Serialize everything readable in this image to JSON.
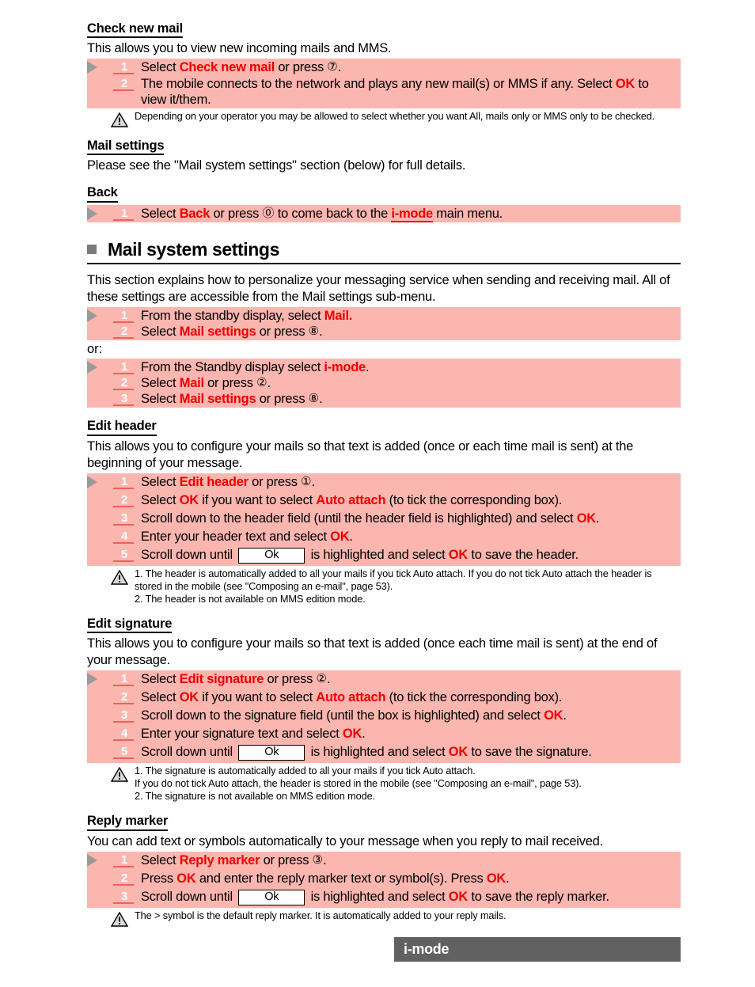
{
  "document": {
    "footer_label": "i-mode"
  },
  "sections": [
    {
      "id": "check-new-mail",
      "heading": "Check new mail",
      "intro": "This allows you to view new incoming mails and MMS.",
      "steps": [
        {
          "num": "1",
          "parts": [
            {
              "t": "text",
              "v": "Select "
            },
            {
              "t": "red",
              "v": "Check new mail"
            },
            {
              "t": "text",
              "v": " or press "
            },
            {
              "t": "circled",
              "v": "⑦"
            },
            {
              "t": "text",
              "v": "."
            }
          ]
        },
        {
          "num": "2",
          "parts": [
            {
              "t": "text",
              "v": "The mobile connects to the network and plays any new mail(s) or MMS if any. Select "
            },
            {
              "t": "red",
              "v": "OK"
            },
            {
              "t": "text",
              "v": " to view it/them."
            }
          ]
        }
      ],
      "note": "Depending on your operator you may be allowed to select whether you want All, mails only or MMS only to be checked."
    },
    {
      "id": "mail-settings",
      "heading": "Mail settings",
      "intro": "Please see the \"Mail system settings\" section (below) for full details."
    },
    {
      "id": "back",
      "heading": "Back",
      "steps": [
        {
          "num": "1",
          "parts": [
            {
              "t": "text",
              "v": "Select "
            },
            {
              "t": "red",
              "v": "Back"
            },
            {
              "t": "text",
              "v": "  or press "
            },
            {
              "t": "circled",
              "v": "⓪"
            },
            {
              "t": "text",
              "v": " to come back to the "
            },
            {
              "t": "imode",
              "v": "i-mode"
            },
            {
              "t": "text",
              "v": " main menu."
            }
          ]
        }
      ]
    }
  ],
  "main_section": {
    "title": "Mail system settings",
    "intro": "This section explains how to personalize your messaging service when sending and receiving mail. All of these settings are accessible from the Mail settings sub-menu.",
    "steps_a": [
      {
        "num": "1",
        "parts": [
          {
            "t": "text",
            "v": "From the standby display, select "
          },
          {
            "t": "red",
            "v": "Mail."
          }
        ]
      },
      {
        "num": "2",
        "parts": [
          {
            "t": "text",
            "v": "Select "
          },
          {
            "t": "red",
            "v": "Mail settings"
          },
          {
            "t": "text",
            "v": " or press "
          },
          {
            "t": "circled",
            "v": "⑧"
          },
          {
            "t": "text",
            "v": "."
          }
        ]
      }
    ],
    "or_label": "or:",
    "steps_b": [
      {
        "num": "1",
        "parts": [
          {
            "t": "text",
            "v": "From the Standby display select "
          },
          {
            "t": "red",
            "v": "i-mode"
          },
          {
            "t": "text",
            "v": "."
          }
        ]
      },
      {
        "num": "2",
        "parts": [
          {
            "t": "text",
            "v": "Select "
          },
          {
            "t": "red",
            "v": "Mail"
          },
          {
            "t": "text",
            "v": " or press "
          },
          {
            "t": "circled",
            "v": "②"
          },
          {
            "t": "text",
            "v": "."
          }
        ]
      },
      {
        "num": "3",
        "parts": [
          {
            "t": "text",
            "v": "Select "
          },
          {
            "t": "red",
            "v": "Mail settings"
          },
          {
            "t": "text",
            "v": " or press "
          },
          {
            "t": "circled",
            "v": "⑧"
          },
          {
            "t": "text",
            "v": "."
          }
        ]
      }
    ]
  },
  "edit_header": {
    "heading": "Edit header",
    "intro": "This allows you to configure your mails so that text is added (once or each time mail is sent) at the beginning of your message.",
    "steps": [
      {
        "num": "1",
        "parts": [
          {
            "t": "text",
            "v": "Select "
          },
          {
            "t": "red",
            "v": "Edit header"
          },
          {
            "t": "text",
            "v": " or press "
          },
          {
            "t": "circled",
            "v": "①"
          },
          {
            "t": "text",
            "v": "."
          }
        ]
      },
      {
        "num": "2",
        "parts": [
          {
            "t": "text",
            "v": "Select "
          },
          {
            "t": "red",
            "v": "OK"
          },
          {
            "t": "text",
            "v": "  if you want to select "
          },
          {
            "t": "red",
            "v": "Auto attach"
          },
          {
            "t": "text",
            "v": " (to tick the corresponding box)."
          }
        ]
      },
      {
        "num": "3",
        "parts": [
          {
            "t": "text",
            "v": "Scroll down to the header field (until the header field is highlighted) and select "
          },
          {
            "t": "red",
            "v": "OK"
          },
          {
            "t": "text",
            "v": "."
          }
        ]
      },
      {
        "num": "4",
        "parts": [
          {
            "t": "text",
            "v": "Enter your header text and select "
          },
          {
            "t": "red",
            "v": "OK"
          },
          {
            "t": "text",
            "v": "."
          }
        ]
      },
      {
        "num": "5",
        "parts": [
          {
            "t": "text",
            "v": "Scroll down until "
          },
          {
            "t": "okbox",
            "v": "Ok"
          },
          {
            "t": "text",
            "v": " is highlighted and select "
          },
          {
            "t": "red",
            "v": "OK"
          },
          {
            "t": "text",
            "v": " to save the header."
          }
        ]
      }
    ],
    "note_lines": [
      "1. The header is automatically added to all  your mails if you tick Auto attach. If you do not tick Auto attach the header is stored in the mobile (see \"Composing an e-mail\", page 53).",
      "2. The header is not available on MMS edition mode."
    ]
  },
  "edit_signature": {
    "heading": "Edit signature",
    "intro": "This allows you to configure your mails so that text is added (once each time mail is sent) at the end of your message.",
    "steps": [
      {
        "num": "1",
        "parts": [
          {
            "t": "text",
            "v": "Select "
          },
          {
            "t": "red",
            "v": "Edit signature"
          },
          {
            "t": "text",
            "v": " or press "
          },
          {
            "t": "circled",
            "v": "②"
          },
          {
            "t": "text",
            "v": "."
          }
        ]
      },
      {
        "num": "2",
        "parts": [
          {
            "t": "text",
            "v": "Select "
          },
          {
            "t": "red",
            "v": "OK"
          },
          {
            "t": "text",
            "v": "  if you want to select "
          },
          {
            "t": "red",
            "v": "Auto attach"
          },
          {
            "t": "text",
            "v": " (to tick the corresponding box)."
          }
        ]
      },
      {
        "num": "3",
        "parts": [
          {
            "t": "text",
            "v": "Scroll down to the signature field (until the box is highlighted) and select "
          },
          {
            "t": "red",
            "v": "OK"
          },
          {
            "t": "text",
            "v": "."
          }
        ]
      },
      {
        "num": "4",
        "parts": [
          {
            "t": "text",
            "v": "Enter your signature text and select "
          },
          {
            "t": "red",
            "v": "OK"
          },
          {
            "t": "text",
            "v": "."
          }
        ]
      },
      {
        "num": "5",
        "parts": [
          {
            "t": "text",
            "v": "Scroll down until "
          },
          {
            "t": "okbox",
            "v": "Ok"
          },
          {
            "t": "text",
            "v": " is highlighted and select "
          },
          {
            "t": "red",
            "v": "OK"
          },
          {
            "t": "text",
            "v": " to save the signature."
          }
        ]
      }
    ],
    "note_lines": [
      "1. The signature is automatically added to all your mails if you tick Auto attach.",
      "If you do not tick Auto attach, the header is stored in the mobile (see \"Composing an e-mail\", page 53).",
      "2. The signature is not available on MMS edition mode."
    ]
  },
  "reply_marker": {
    "heading": "Reply marker",
    "intro": "You can add text or symbols automatically to your message when you reply to mail received.",
    "steps": [
      {
        "num": "1",
        "parts": [
          {
            "t": "text",
            "v": "Select "
          },
          {
            "t": "red",
            "v": "Reply marker"
          },
          {
            "t": "text",
            "v": " or press "
          },
          {
            "t": "circled",
            "v": "③"
          },
          {
            "t": "text",
            "v": "."
          }
        ]
      },
      {
        "num": "2",
        "parts": [
          {
            "t": "text",
            "v": "Press "
          },
          {
            "t": "red",
            "v": "OK"
          },
          {
            "t": "text",
            "v": " and enter the reply marker text or symbol(s). Press "
          },
          {
            "t": "red",
            "v": "OK"
          },
          {
            "t": "text",
            "v": "."
          }
        ]
      },
      {
        "num": "3",
        "parts": [
          {
            "t": "text",
            "v": "Scroll down until "
          },
          {
            "t": "okbox",
            "v": "Ok"
          },
          {
            "t": "text",
            "v": " is highlighted and select "
          },
          {
            "t": "red",
            "v": "OK"
          },
          {
            "t": "text",
            "v": " to save the reply marker."
          }
        ]
      }
    ],
    "note_lines": [
      "The > symbol is the default reply marker. It is automatically added to your reply mails."
    ]
  },
  "colors": {
    "step_background": "#fbb6b0",
    "accent_red": "#ee0000",
    "number_underline": "#f0605c",
    "marker_gray": "#9a9a9a",
    "footer_gray": "#616161",
    "bullet_gray": "#7b7b7b"
  },
  "icons": {
    "step_marker": "play-triangle-icon",
    "note": "warning-triangle-icon",
    "section_bullet": "square-bullet-icon"
  }
}
